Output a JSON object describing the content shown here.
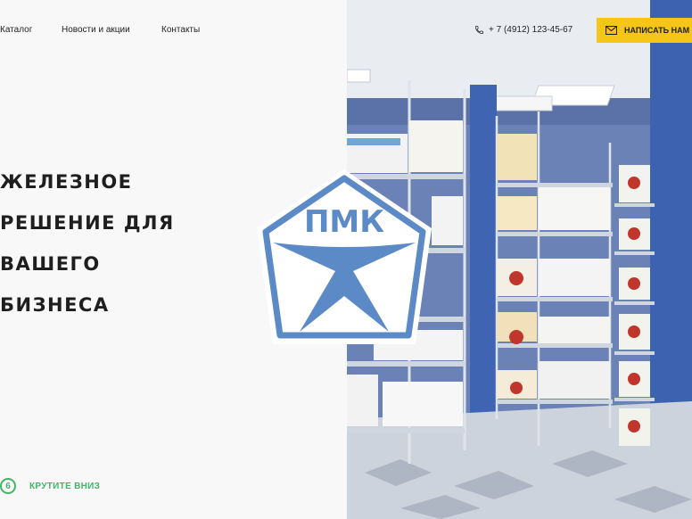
{
  "nav": {
    "items": [
      {
        "label": "Каталог"
      },
      {
        "label": "Новости и акции"
      },
      {
        "label": "Контакты"
      }
    ]
  },
  "header": {
    "phone": "+ 7 (4912) 123-45-67",
    "cta_label": "НАПИСАТЬ НАМ"
  },
  "hero": {
    "lines": [
      "ЖЕЛЕЗНОЕ",
      "РЕШЕНИЕ ДЛЯ",
      "ВАШЕГО",
      "БИЗНЕСА"
    ]
  },
  "logo": {
    "text": "ПМК"
  },
  "scroll": {
    "label": "КРУТИТЕ ВНИЗ"
  },
  "colors": {
    "accent_yellow": "#f5c518",
    "accent_green": "#48b368",
    "logo_blue": "#5b8ac6"
  },
  "icons": {
    "phone": "phone-icon",
    "mail": "envelope-icon",
    "scroll": "scroll-down-icon"
  }
}
